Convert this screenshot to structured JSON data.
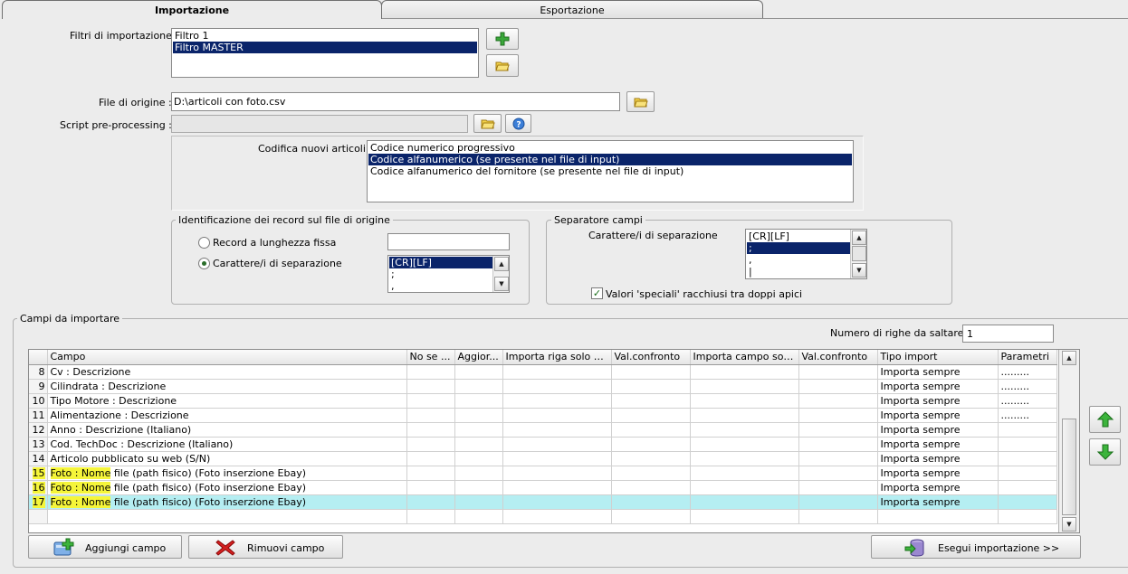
{
  "tabs": [
    {
      "label": "Importazione",
      "active": true
    },
    {
      "label": "Esportazione",
      "active": false
    }
  ],
  "filters": {
    "label": "Filtri di importazione :",
    "items": [
      "Filtro 1",
      "Filtro MASTER"
    ],
    "selected_index": 1
  },
  "source_file": {
    "label": "File di origine :",
    "value": "D:\\articoli con foto.csv"
  },
  "script": {
    "label": "Script pre-processing :",
    "value": ""
  },
  "encoding": {
    "label": "Codifica nuovi articoli :",
    "items": [
      "Codice numerico progressivo",
      "Codice alfanumerico (se presente nel file di input)",
      "Codice alfanumerico del fornitore (se presente nel file di input)"
    ],
    "selected_index": 1
  },
  "record_id": {
    "title": "Identificazione dei record sul file di origine",
    "fixed_label": "Record a lunghezza fissa",
    "sep_label": "Carattere/i di separazione",
    "selected": "sep",
    "sep_items": [
      "[CR][LF]",
      ";",
      ","
    ]
  },
  "field_sep": {
    "title": "Separatore campi",
    "label": "Carattere/i di separazione",
    "items": [
      "[CR][LF]",
      ";",
      ",",
      "|"
    ],
    "quotes_label": "Valori 'speciali' racchiusi tra doppi apici",
    "quotes_checked": true
  },
  "fields": {
    "title": "Campi da importare",
    "skip_label": "Numero di righe da saltare :",
    "skip_value": "1",
    "columns": [
      "Campo",
      "No se ...",
      "Aggior...",
      "Importa riga solo se...",
      "Val.confronto",
      "Importa campo solo s...",
      "Val.confronto",
      "Tipo import",
      "Parametri"
    ],
    "rows": [
      {
        "n": "8",
        "campo": "Cv : Descrizione",
        "tipo": "Importa sempre",
        "param": "........."
      },
      {
        "n": "9",
        "campo": "Cilindrata : Descrizione",
        "tipo": "Importa sempre",
        "param": "........."
      },
      {
        "n": "10",
        "campo": "Tipo Motore : Descrizione",
        "tipo": "Importa sempre",
        "param": "........."
      },
      {
        "n": "11",
        "campo": "Alimentazione : Descrizione",
        "tipo": "Importa sempre",
        "param": "........."
      },
      {
        "n": "12",
        "campo": "Anno : Descrizione (Italiano)",
        "tipo": "Importa sempre",
        "param": ""
      },
      {
        "n": "13",
        "campo": "Cod. TechDoc : Descrizione (Italiano)",
        "tipo": "Importa sempre",
        "param": ""
      },
      {
        "n": "14",
        "campo": "Articolo pubblicato su web (S/N)",
        "tipo": "Importa sempre",
        "param": ""
      },
      {
        "n": "15",
        "campo": "Foto : Nome file (path fisico) (Foto inserzione Ebay)",
        "tipo": "Importa sempre",
        "param": ""
      },
      {
        "n": "16",
        "campo": "Foto : Nome file (path fisico) (Foto inserzione Ebay)",
        "tipo": "Importa sempre",
        "param": ""
      },
      {
        "n": "17",
        "campo": "Foto : Nome file (path fisico) (Foto inserzione Ebay)",
        "tipo": "Importa sempre",
        "param": ""
      }
    ],
    "current_row": 9
  },
  "buttons": {
    "add_field": "Aggiungi campo",
    "remove_field": "Rimuovi campo",
    "run_import": "Esegui importazione >>"
  },
  "icons": {
    "add": "plus-icon",
    "folder": "folder-icon",
    "help": "help-icon",
    "up": "arrow-up-icon",
    "down": "arrow-down-icon",
    "remove": "red-x-icon",
    "import": "database-icon"
  },
  "colors": {
    "selection": "#0a246a",
    "current_row": "#b5eef2",
    "highlight": "#f5f53a",
    "arrow_green": "#2e9a2e",
    "remove_red": "#d42020"
  }
}
